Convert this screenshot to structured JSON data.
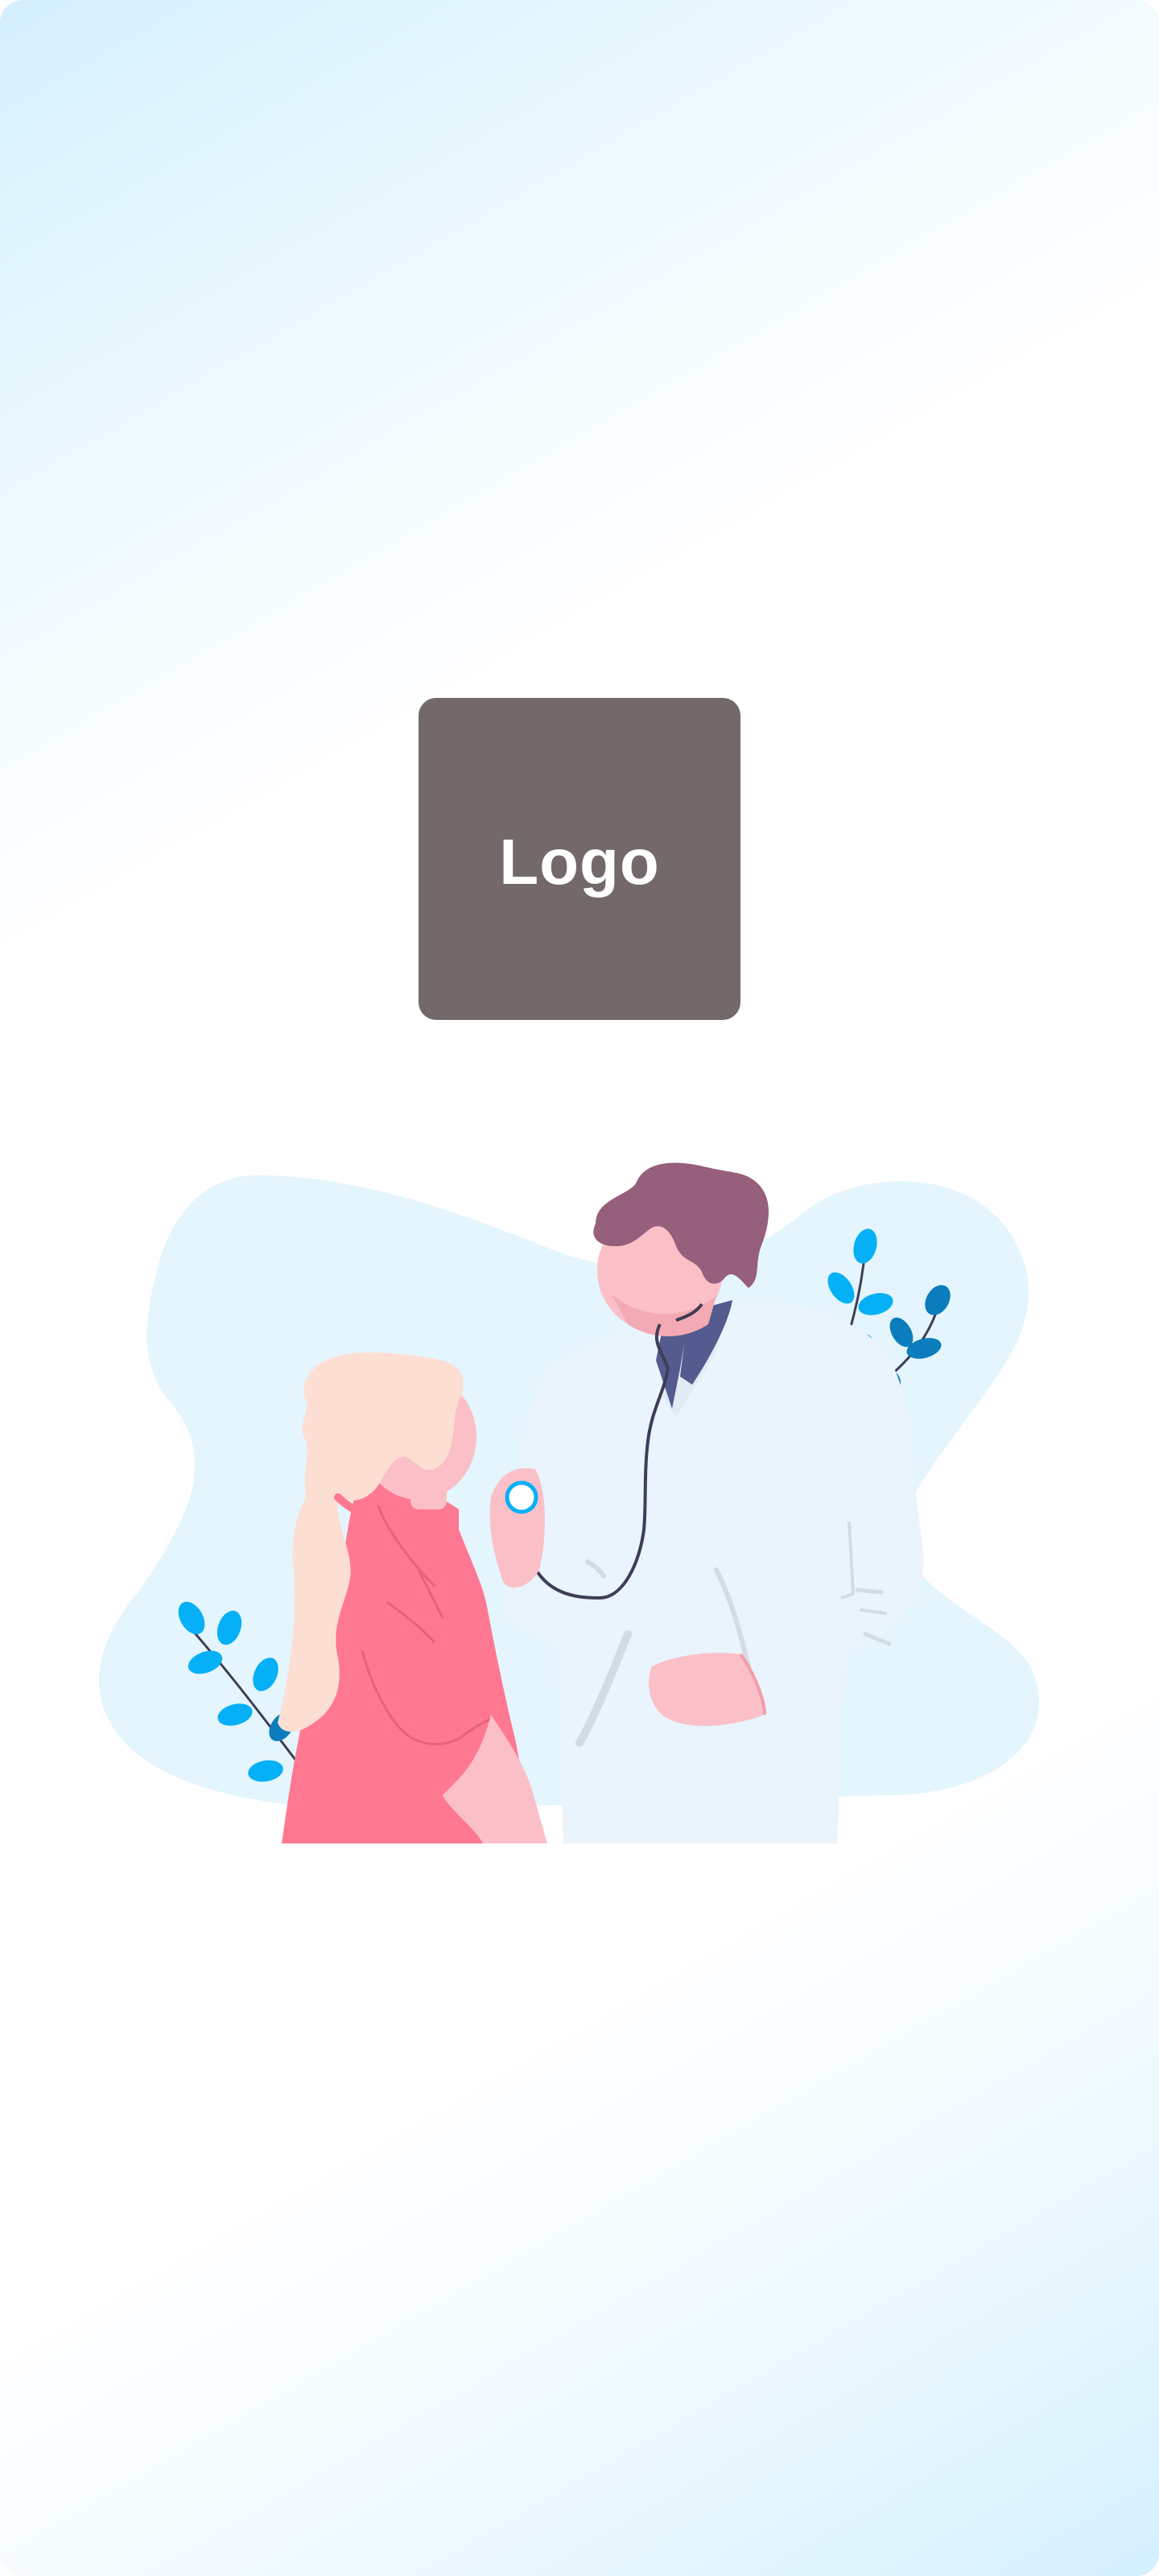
{
  "splash": {
    "logo_text": "Logo",
    "logo_bg_color": "#726968",
    "illustration_icon": "doctor-patient-illustration"
  },
  "colors": {
    "background_tint": "#d3f0fd",
    "blob": "#e4f5fd",
    "leaf_light": "#06b0f6",
    "leaf_dark": "#0b7dbd",
    "doctor_hair": "#965f7c",
    "skin": "#fbc0c7",
    "patient_shirt": "#ff7891",
    "patient_hair": "#fcdfd2",
    "coat": "#e9f4fd",
    "tie": "#545b8f"
  }
}
